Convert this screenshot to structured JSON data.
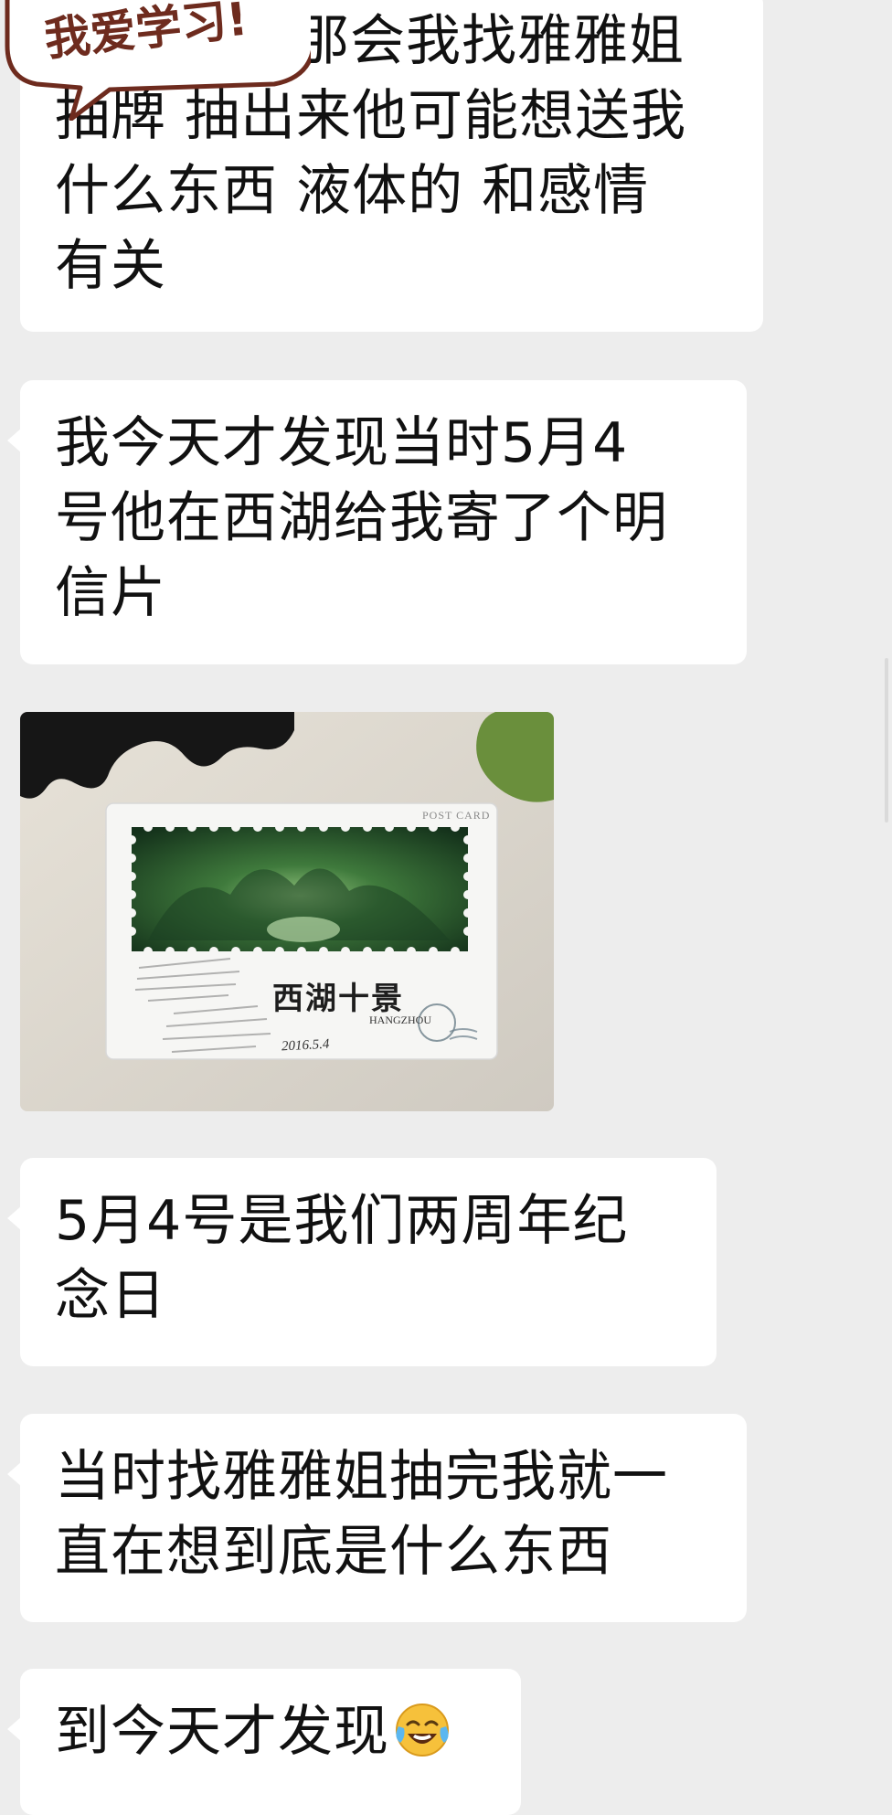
{
  "messages": [
    {
      "id": 1,
      "lines": [
        "那会我找雅雅姐",
        "抽牌 抽出来他可能想送我",
        "什么东西 液体的 和感情",
        "有关"
      ]
    },
    {
      "id": 2,
      "lines": [
        "我今天才发现当时5月4",
        "号他在西湖给我寄了个明",
        "信片"
      ]
    },
    {
      "id": 3,
      "type": "image",
      "postcard_header": "POST CARD",
      "postcard_title": "西湖十景",
      "postcard_city": "HANGZHOU",
      "postcard_date": "2016.5.4"
    },
    {
      "id": 4,
      "lines": [
        "5月4号是我们两周年纪",
        "念日"
      ]
    },
    {
      "id": 5,
      "lines": [
        "当时找雅雅姐抽完我就一",
        "直在想到底是什么东西"
      ]
    },
    {
      "id": 6,
      "lines": [
        "到今天才发现"
      ],
      "emoji": "laughing-tears-emoji"
    }
  ],
  "sticker": {
    "text": "我爱学习!",
    "icon": "speech-bubble-sticker"
  },
  "colors": {
    "background": "#ededed",
    "bubble": "#ffffff",
    "text": "#111111",
    "sticker_text": "#6e2b1e"
  }
}
